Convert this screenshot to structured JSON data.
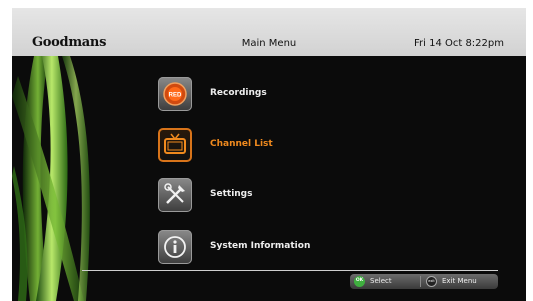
{
  "header": {
    "brand": "Goodmans",
    "title": "Main Menu",
    "datetime": "Fri 14 Oct 8:22pm"
  },
  "menu": {
    "items": [
      {
        "label": "Recordings",
        "icon": "record-red-icon",
        "selected": false
      },
      {
        "label": "Channel List",
        "icon": "tv-icon",
        "selected": true
      },
      {
        "label": "Settings",
        "icon": "tools-icon",
        "selected": false
      },
      {
        "label": "System Information",
        "icon": "info-icon",
        "selected": false
      }
    ]
  },
  "footer": {
    "select_label": "Select",
    "select_key": "OK",
    "exit_label": "Exit Menu",
    "exit_key": "exit"
  },
  "colors": {
    "selected_text": "#f08a1e",
    "header_bg": "#dcdcdc",
    "screen_bg": "#0b0b0b",
    "ok_button": "#3fae3f"
  }
}
